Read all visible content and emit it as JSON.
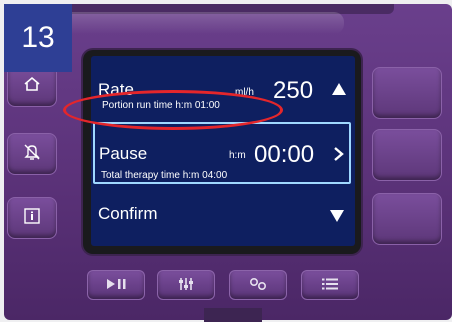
{
  "step_badge": "13",
  "screen": {
    "rate": {
      "label": "Rate",
      "unit": "ml/h",
      "value": "250",
      "sub": "Portion run time h:m 01:00"
    },
    "pause": {
      "label": "Pause",
      "unit": "h:m",
      "value": "00:00",
      "sub": "Total therapy time h:m 04:00"
    },
    "confirm": {
      "label": "Confirm"
    }
  },
  "colors": {
    "screen_bg": "#0e1f60",
    "device_body": "#5b3279",
    "selection_border": "#9fd8ff",
    "highlight_ring": "#e4262b",
    "badge_bg": "#2e3f95"
  },
  "icons": {
    "left_buttons": [
      "home-icon",
      "bell-mute-icon",
      "info-icon"
    ],
    "bottom_buttons": [
      "play-pause-icon",
      "sliders-icon",
      "link-icon",
      "list-icon"
    ],
    "screen": [
      "arrow-up-icon",
      "chevron-right-icon",
      "arrow-down-icon"
    ]
  }
}
